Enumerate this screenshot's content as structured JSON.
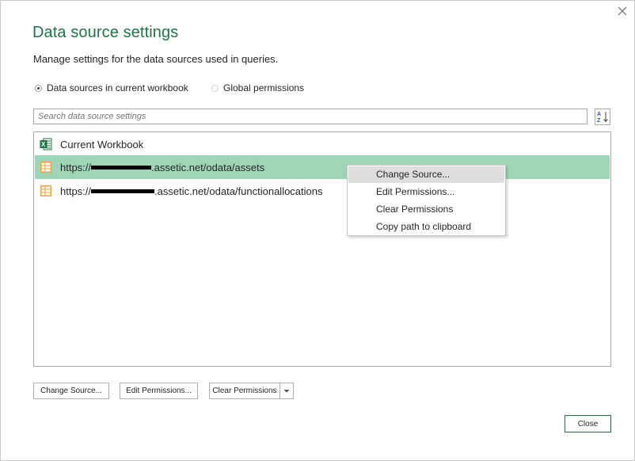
{
  "dialog": {
    "title": "Data source settings",
    "subtitle": "Manage settings for the data sources used in queries.",
    "accent_color": "#217346",
    "selection_color": "#9fd5b7"
  },
  "scope": {
    "options": [
      {
        "label": "Data sources in current workbook",
        "selected": true
      },
      {
        "label": "Global permissions",
        "selected": false
      }
    ]
  },
  "search": {
    "placeholder": "Search data source settings",
    "sort_icon": "sort-az-icon"
  },
  "list": {
    "items": [
      {
        "prefix": "Current Workbook",
        "suffix": "",
        "icon": "excel-icon",
        "selected": false,
        "redacted": false
      },
      {
        "prefix": "https://",
        "suffix": ".assetic.net/odata/assets",
        "icon": "odata-feed-icon",
        "selected": true,
        "redacted": true
      },
      {
        "prefix": "https://",
        "suffix": ".assetic.net/odata/functionallocations",
        "icon": "odata-feed-icon",
        "selected": false,
        "redacted": true
      }
    ]
  },
  "context_menu": {
    "items": [
      "Change Source...",
      "Edit Permissions...",
      "Clear Permissions",
      "Copy path to clipboard"
    ]
  },
  "buttons": {
    "change_source": "Change Source...",
    "edit_permissions": "Edit Permissions...",
    "clear_permissions": "Clear Permissions",
    "close": "Close"
  }
}
